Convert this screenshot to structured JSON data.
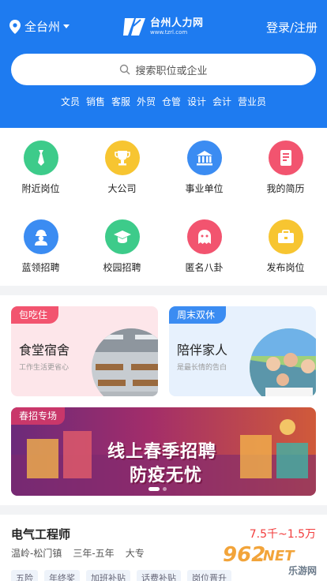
{
  "header": {
    "city": "全台州",
    "logo_name": "台州人力网",
    "logo_url": "www.tzrl.com",
    "login_label": "登录/注册",
    "search_placeholder": "搜索职位或企业",
    "hotwords": [
      "文员",
      "销售",
      "客服",
      "外贸",
      "仓管",
      "设计",
      "会计",
      "营业员"
    ],
    "brand_color": "#1e7bf0"
  },
  "grid": {
    "items": [
      {
        "label": "附近岗位",
        "icon": "tie-icon",
        "color": "#3dcb8a"
      },
      {
        "label": "大公司",
        "icon": "trophy-icon",
        "color": "#f7c531"
      },
      {
        "label": "事业单位",
        "icon": "bank-icon",
        "color": "#3b8cf2"
      },
      {
        "label": "我的简历",
        "icon": "resume-icon",
        "color": "#f2546f"
      },
      {
        "label": "蓝领招聘",
        "icon": "worker-icon",
        "color": "#3b8cf2"
      },
      {
        "label": "校园招聘",
        "icon": "graduation-cap-icon",
        "color": "#3dcb8a"
      },
      {
        "label": "匿名八卦",
        "icon": "ghost-icon",
        "color": "#f2546f"
      },
      {
        "label": "发布岗位",
        "icon": "briefcase-icon",
        "color": "#f7c531"
      }
    ]
  },
  "cards": [
    {
      "tag": "包吃住",
      "title": "食堂宿舍",
      "subtitle": "工作生活更省心"
    },
    {
      "tag": "周末双休",
      "title": "陪伴家人",
      "subtitle": "是最长情的告白"
    }
  ],
  "banner": {
    "tag": "春招专场",
    "headline1": "线上春季招聘",
    "headline2": "防疫无忧"
  },
  "job": {
    "title": "电气工程师",
    "salary": "7.5千~1.5万",
    "location": "温岭-松门镇",
    "experience": "三年-五年",
    "education": "大专",
    "tags": [
      "五险",
      "年终奖",
      "加班补贴",
      "话费补贴",
      "岗位晋升"
    ]
  },
  "watermark": {
    "num": "962",
    "dot": ".NET",
    "text": "乐游网"
  }
}
